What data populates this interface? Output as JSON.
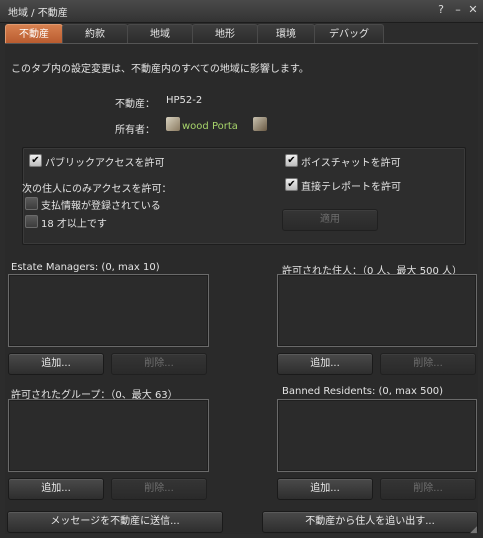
{
  "window": {
    "title": "地域 / 不動産",
    "help_glyph": "?",
    "minimize_glyph": "–",
    "close_glyph": "✕"
  },
  "tabs": [
    {
      "label": "不動産"
    },
    {
      "label": "約款"
    },
    {
      "label": "地域"
    },
    {
      "label": "地形"
    },
    {
      "label": "環境"
    },
    {
      "label": "デバッグ"
    }
  ],
  "info": {
    "notice": "このタブ内の設定変更は、不動産内のすべての地域に影響します。",
    "estate_label": "不動産：",
    "estate_value": "HP52-2",
    "owner_label": "所有者：",
    "owner_value": "wood Porta"
  },
  "access": {
    "public_access": {
      "label": "パブリックアクセスを許可",
      "checked": true
    },
    "restrict_label": "次の住人にのみアクセスを許可：",
    "payment_info": {
      "label": "支払情報が登録されている",
      "checked": false
    },
    "age_18": {
      "label": "18 才以上です",
      "checked": false
    },
    "voice_chat": {
      "label": "ボイスチャットを許可",
      "checked": true
    },
    "direct_teleport": {
      "label": "直接テレポートを許可",
      "checked": true
    },
    "apply_label": "適用",
    "check_glyph": "✔"
  },
  "lists": {
    "managers": {
      "title": "Estate Managers: (0, max 10)",
      "add": "追加...",
      "remove": "削除..."
    },
    "allowed_residents": {
      "title": "許可された住人：（0 人、最大 500 人）",
      "add": "追加...",
      "remove": "削除..."
    },
    "allowed_groups": {
      "title": "許可されたグループ：（0、最大 63）",
      "add": "追加...",
      "remove": "削除..."
    },
    "banned": {
      "title": "Banned Residents: (0, max 500)",
      "add": "追加...",
      "remove": "削除..."
    }
  },
  "footer": {
    "send_message": "メッセージを不動産に送信...",
    "kick_user": "不動産から住人を追い出す..."
  },
  "colors": {
    "accent_tab": "#c8663a",
    "owner_link": "#a6d36a",
    "background": "#2a2a2a"
  }
}
